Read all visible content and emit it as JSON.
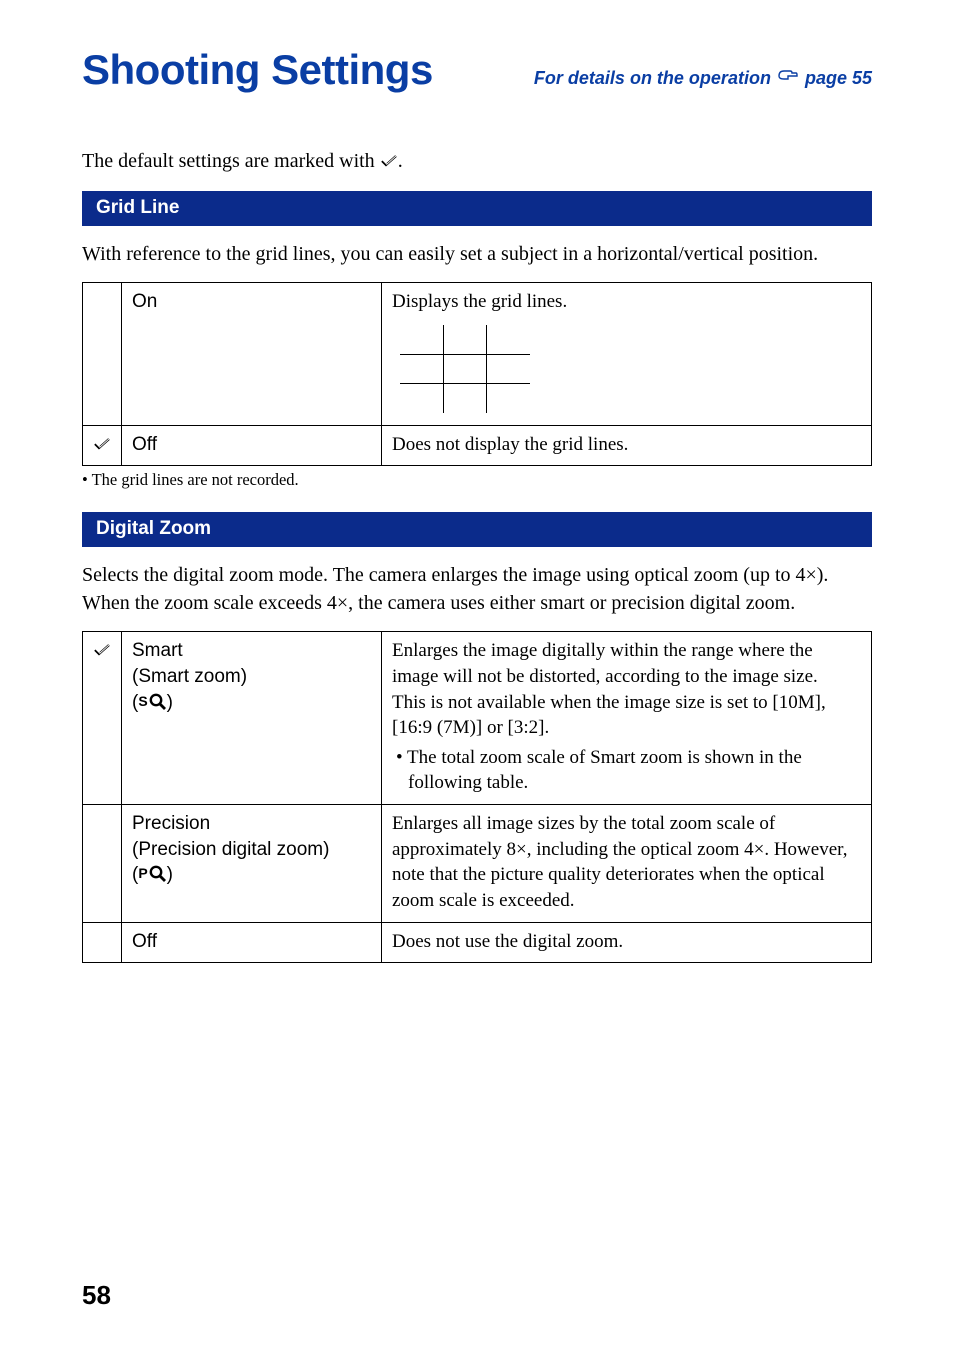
{
  "header": {
    "title": "Shooting Settings",
    "note_prefix": "For details on the operation ",
    "note_page": "page 55"
  },
  "intro": "The default settings are marked with ",
  "intro_suffix": ".",
  "sections": {
    "grid": {
      "title": "Grid Line",
      "desc": "With reference to the grid lines, you can easily set a subject in a horizontal/vertical position.",
      "rows": {
        "on": {
          "label": "On",
          "desc": "Displays the grid lines."
        },
        "off": {
          "label": "Off",
          "desc": "Does not display the grid lines."
        }
      },
      "note": "• The grid lines are not recorded."
    },
    "zoom": {
      "title": "Digital Zoom",
      "desc": "Selects the digital zoom mode. The camera enlarges the image using optical zoom (up to 4×). When the zoom scale exceeds 4×, the camera uses either smart or precision digital zoom.",
      "rows": {
        "smart": {
          "label1": "Smart",
          "label2": "(Smart zoom)",
          "sym_open": "(",
          "sym_prefix": "S",
          "sym_close": ")",
          "desc1": "Enlarges the image digitally within the range where the image will not be distorted, according to the image size.",
          "desc2": "This is not available when the image size is set to [10M], [16:9 (7M)] or [3:2].",
          "bullet": "• The total zoom scale of Smart zoom is shown in the following table."
        },
        "precision": {
          "label1": "Precision",
          "label2": "(Precision digital zoom)",
          "sym_open": "(",
          "sym_prefix": "P",
          "sym_close": ")",
          "desc": "Enlarges all image sizes by the total zoom scale of approximately 8×, including the optical zoom 4×. However, note that the picture quality deteriorates when the optical zoom scale is exceeded."
        },
        "off": {
          "label": "Off",
          "desc": "Does not use the digital zoom."
        }
      }
    }
  },
  "page_number": "58",
  "chart_data": null
}
